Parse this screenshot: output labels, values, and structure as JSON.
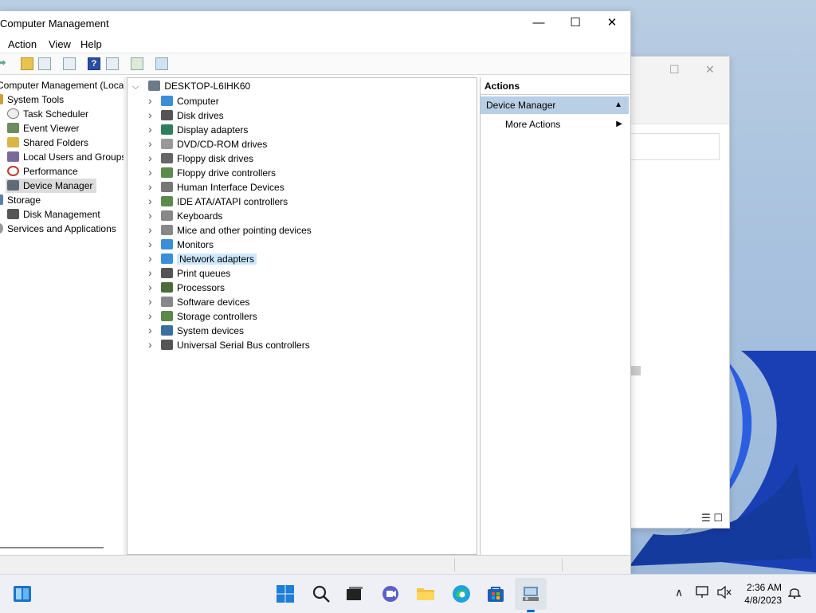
{
  "window": {
    "title": "Computer Management",
    "minimize": "—",
    "maximize": "☐",
    "close": "✕"
  },
  "menu": [
    "Action",
    "View",
    "Help"
  ],
  "toolbar": {
    "back_arrow": "➡",
    "forward_arrow": "➡",
    "help_label": "?"
  },
  "left_tree": [
    {
      "label": "Computer Management (Local",
      "icon": "computer-icon",
      "color": "#5a7fa8"
    },
    {
      "label": "System Tools",
      "icon": "tools-icon",
      "color": "#c9a23a"
    },
    {
      "label": "Task Scheduler",
      "icon": "clock-icon",
      "color": "#9a9a9a"
    },
    {
      "label": "Event Viewer",
      "icon": "event-viewer-icon",
      "color": "#6d8b5e"
    },
    {
      "label": "Shared Folders",
      "icon": "shared-folder-icon",
      "color": "#d9b447"
    },
    {
      "label": "Local Users and Groups",
      "icon": "users-icon",
      "color": "#7a6a9a"
    },
    {
      "label": "Performance",
      "icon": "performance-icon",
      "color": "#c0392b"
    },
    {
      "label": "Device Manager",
      "icon": "device-manager-icon",
      "color": "#5f6b78"
    },
    {
      "label": "Storage",
      "icon": "storage-icon",
      "color": "#5a7fa8"
    },
    {
      "label": "Disk Management",
      "icon": "disk-icon",
      "color": "#555"
    },
    {
      "label": "Services and Applications",
      "icon": "services-icon",
      "color": "#888"
    }
  ],
  "device_root": "DESKTOP-L6IHK60",
  "devices": [
    {
      "label": "Computer",
      "icon": "monitor-icon",
      "color": "#3b8fd9"
    },
    {
      "label": "Disk drives",
      "icon": "disk-drive-icon",
      "color": "#555"
    },
    {
      "label": "Display adapters",
      "icon": "display-adapter-icon",
      "color": "#2f7f5f"
    },
    {
      "label": "DVD/CD-ROM drives",
      "icon": "dvd-icon",
      "color": "#999"
    },
    {
      "label": "Floppy disk drives",
      "icon": "floppy-icon",
      "color": "#666"
    },
    {
      "label": "Floppy drive controllers",
      "icon": "controller-icon",
      "color": "#5b8a4a"
    },
    {
      "label": "Human Interface Devices",
      "icon": "hid-icon",
      "color": "#777"
    },
    {
      "label": "IDE ATA/ATAPI controllers",
      "icon": "ide-icon",
      "color": "#5b8a4a"
    },
    {
      "label": "Keyboards",
      "icon": "keyboard-icon",
      "color": "#888"
    },
    {
      "label": "Mice and other pointing devices",
      "icon": "mouse-icon",
      "color": "#888"
    },
    {
      "label": "Monitors",
      "icon": "monitor-icon",
      "color": "#3b8fd9"
    },
    {
      "label": "Network adapters",
      "icon": "network-icon",
      "color": "#3b8fd9"
    },
    {
      "label": "Print queues",
      "icon": "printer-icon",
      "color": "#555"
    },
    {
      "label": "Processors",
      "icon": "cpu-icon",
      "color": "#4a6b3a"
    },
    {
      "label": "Software devices",
      "icon": "software-device-icon",
      "color": "#888"
    },
    {
      "label": "Storage controllers",
      "icon": "storage-controller-icon",
      "color": "#5b8a4a"
    },
    {
      "label": "System devices",
      "icon": "system-device-icon",
      "color": "#3b6f9f"
    },
    {
      "label": "Universal Serial Bus controllers",
      "icon": "usb-icon",
      "color": "#555"
    }
  ],
  "actions": {
    "header": "Actions",
    "section": "Device Manager",
    "more": "More Actions"
  },
  "bg_window": {
    "maximize": "☐",
    "close": "✕",
    "view_icons": "☰ ☐"
  },
  "taskbar": {
    "time": "2:36 AM",
    "date": "4/8/2023",
    "chevron": "∧"
  },
  "colors": {
    "accent": "#0067c0",
    "selection": "#cce8ff",
    "actions_section": "#b8cfe6"
  }
}
